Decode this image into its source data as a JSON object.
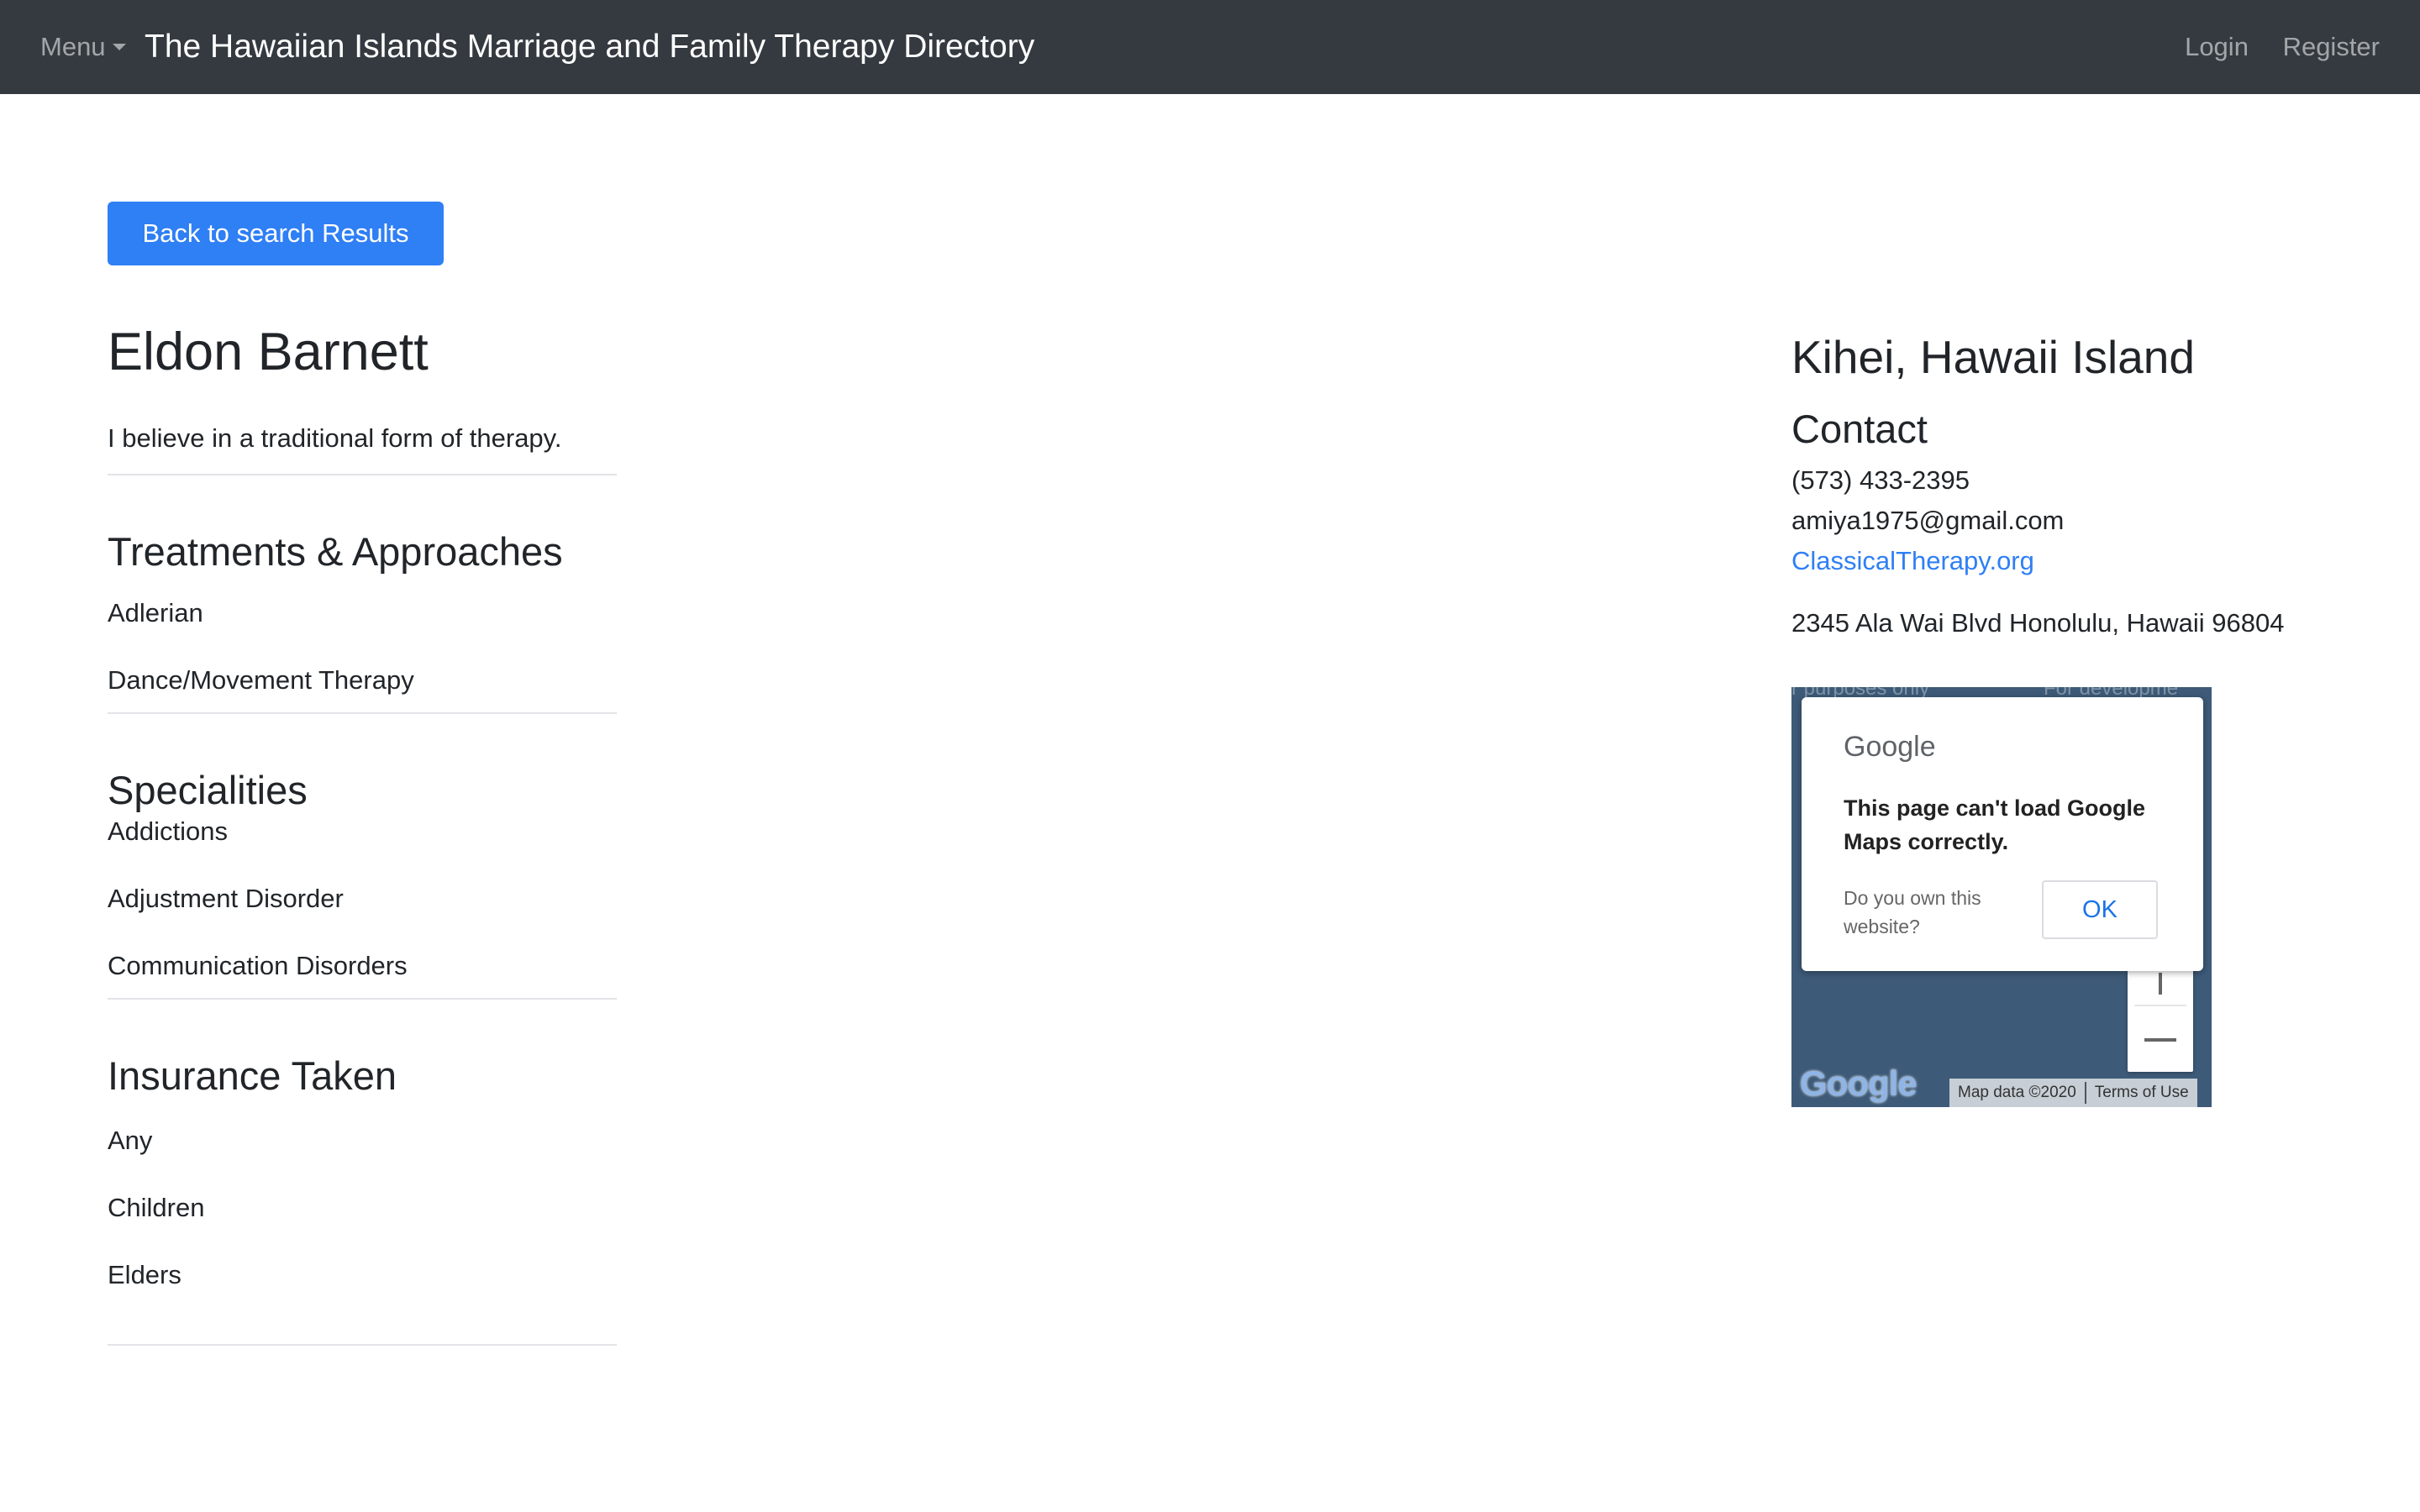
{
  "navbar": {
    "menu_label": "Menu",
    "brand": "The Hawaiian Islands Marriage and Family Therapy Directory",
    "login": "Login",
    "register": "Register"
  },
  "back_button": "Back to search Results",
  "profile": {
    "name": "Eldon Barnett",
    "bio": "I believe in a traditional form of therapy.",
    "treatments_title": "Treatments & Approaches",
    "treatments": [
      "Adlerian",
      "Dance/Movement Therapy"
    ],
    "specialities_title": "Specialities",
    "specialities": [
      "Addictions",
      "Adjustment Disorder",
      "Communication Disorders"
    ],
    "insurance_title": "Insurance Taken",
    "insurance": [
      "Any",
      "Children",
      "Elders"
    ]
  },
  "contact": {
    "location": "Kihei, Hawaii Island",
    "heading": "Contact",
    "phone": "(573) 433-2395",
    "email": "amiya1975@gmail.com",
    "website": "ClassicalTherapy.org",
    "address": "2345 Ala Wai Blvd Honolulu, Hawaii 96804"
  },
  "map": {
    "dev_text_left": "r purposes only",
    "dev_text_right": "For developme",
    "dialog_logo": "Google",
    "dialog_message": "This page can't load Google Maps correctly.",
    "dialog_question": "Do you own this website?",
    "dialog_ok": "OK",
    "watermark": "Google",
    "map_data": "Map data ©2020",
    "terms": "Terms of Use"
  },
  "colors": {
    "navbar_bg": "#343a40",
    "primary": "#2f7ff5",
    "map_bg": "#3d5a78"
  }
}
